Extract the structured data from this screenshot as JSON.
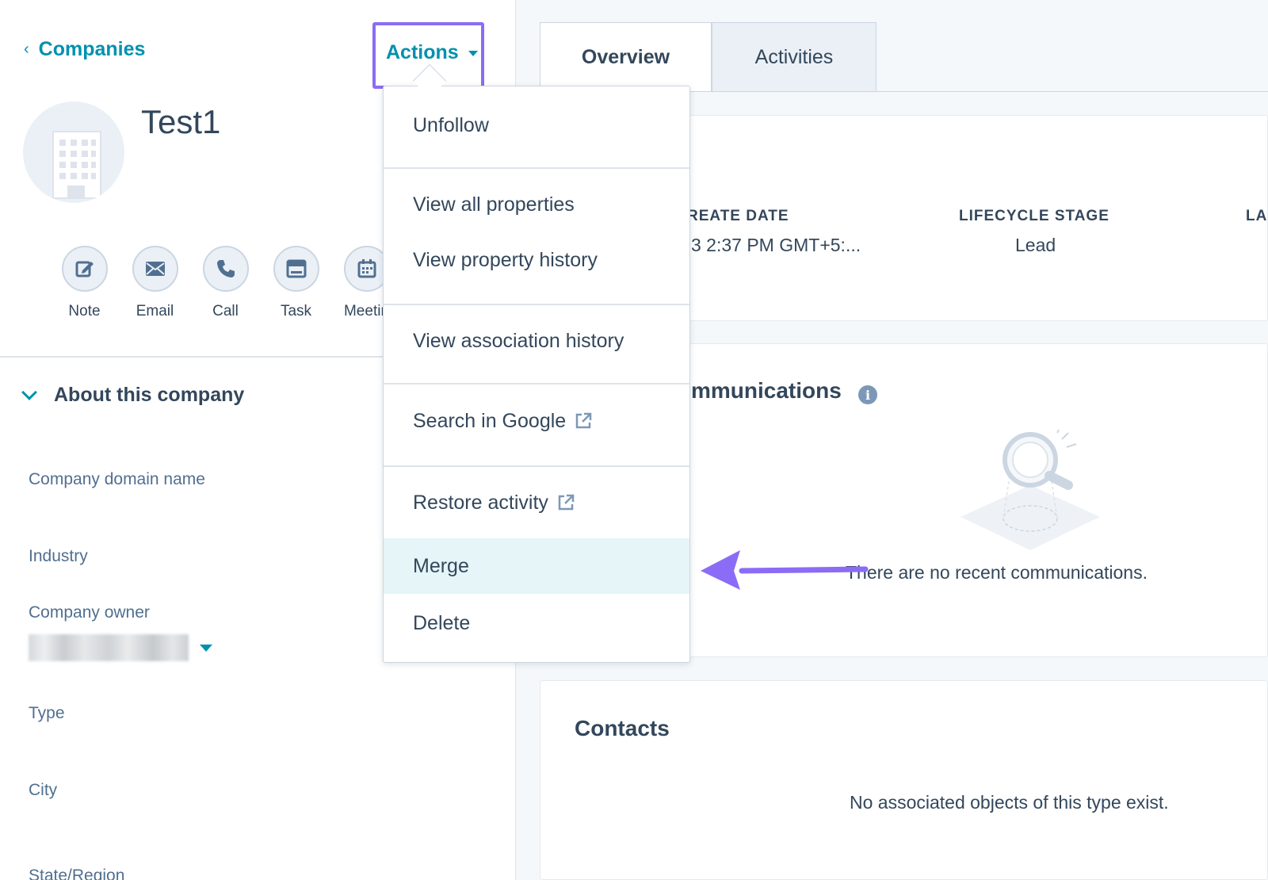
{
  "breadcrumb": {
    "back_label": "Companies"
  },
  "header": {
    "actions_label": "Actions",
    "title": "Test1"
  },
  "quick_actions": [
    {
      "label": "Note",
      "icon": "note-edit-icon"
    },
    {
      "label": "Email",
      "icon": "envelope-icon"
    },
    {
      "label": "Call",
      "icon": "phone-icon"
    },
    {
      "label": "Task",
      "icon": "task-icon"
    },
    {
      "label": "Meetin",
      "icon": "calendar-icon"
    }
  ],
  "about": {
    "title": "About this company",
    "properties": [
      {
        "label": "Company domain name"
      },
      {
        "label": "Industry"
      },
      {
        "label": "Company owner"
      },
      {
        "label": "Type"
      },
      {
        "label": "City"
      },
      {
        "label": "State/Region"
      }
    ]
  },
  "tabs": [
    {
      "label": "Overview",
      "active": true
    },
    {
      "label": "Activities",
      "active": false
    }
  ],
  "summary": {
    "create_date_header": "REATE DATE",
    "create_date_value": "3 2:37 PM GMT+5:...",
    "lifecycle_header": "LIFECYCLE STAGE",
    "lifecycle_value": "Lead",
    "last_header": "LA"
  },
  "communications": {
    "title": "mmunications",
    "empty_text": "There are no recent communications."
  },
  "contacts": {
    "title": "Contacts",
    "empty_text": "No associated objects of this type exist."
  },
  "menu": {
    "unfollow": "Unfollow",
    "view_all_properties": "View all properties",
    "view_property_history": "View property history",
    "view_association_history": "View association history",
    "search_google": "Search in Google",
    "restore_activity": "Restore activity",
    "merge": "Merge",
    "delete": "Delete"
  },
  "colors": {
    "accent": "#0091ae",
    "highlight_border": "#8b6cf6",
    "menu_highlight": "#e5f5f8",
    "text": "#33475b"
  }
}
